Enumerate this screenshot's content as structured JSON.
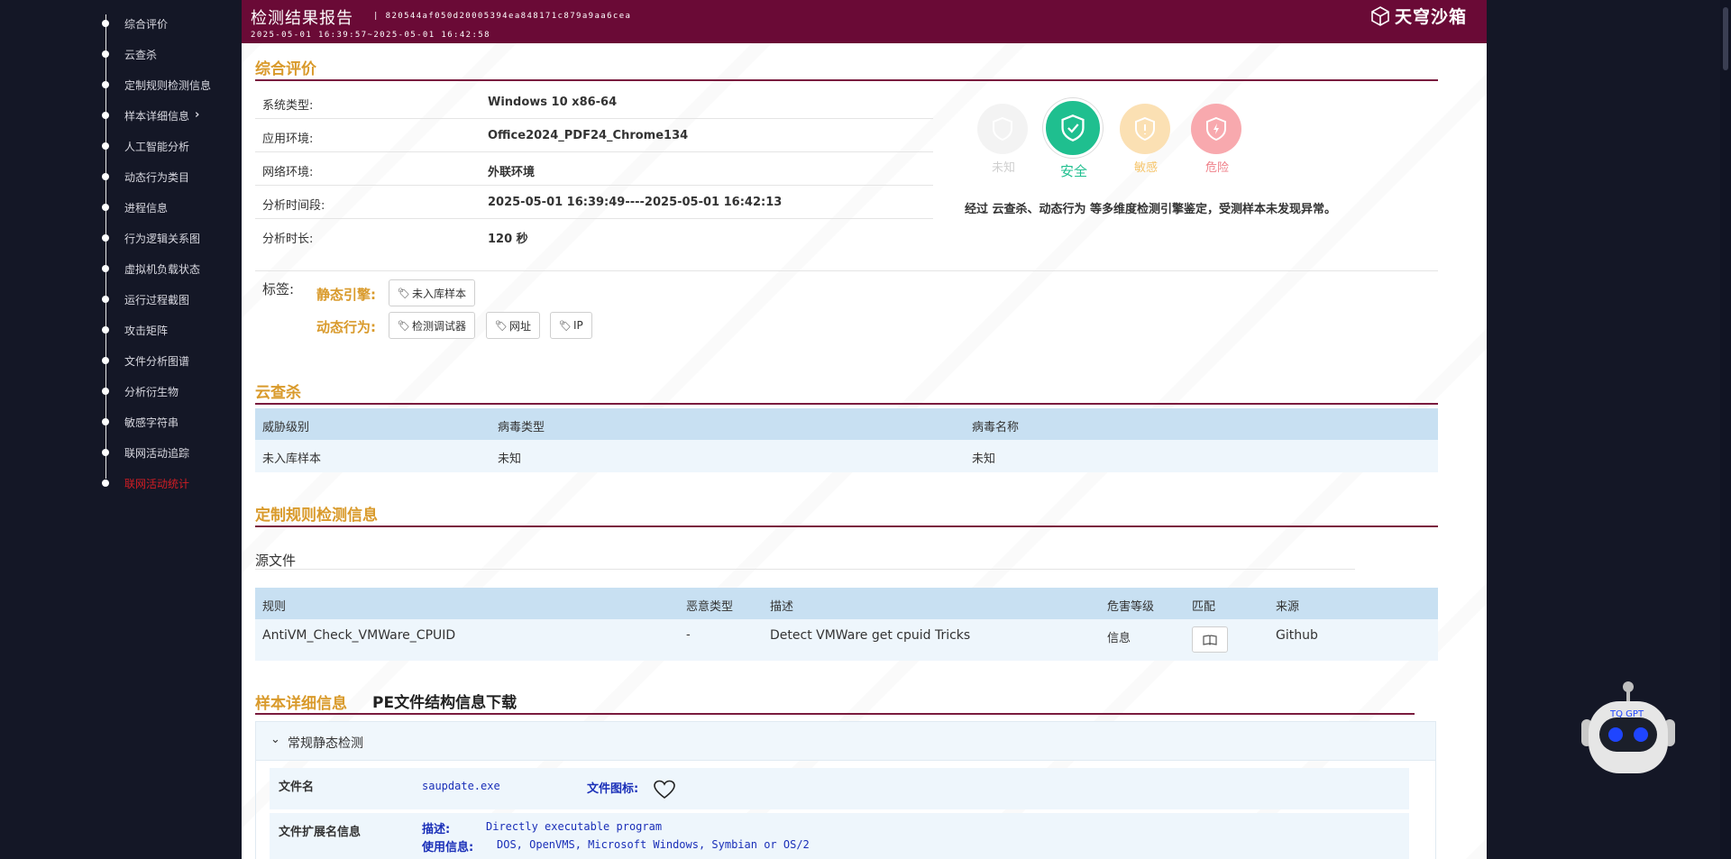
{
  "sidebar": {
    "items": [
      {
        "label": "综合评价"
      },
      {
        "label": "云查杀"
      },
      {
        "label": "定制规则检测信息"
      },
      {
        "label": "样本详细信息"
      },
      {
        "label": "人工智能分析"
      },
      {
        "label": "动态行为类目"
      },
      {
        "label": "进程信息"
      },
      {
        "label": "行为逻辑关系图"
      },
      {
        "label": "虚拟机负载状态"
      },
      {
        "label": "运行过程截图"
      },
      {
        "label": "攻击矩阵"
      },
      {
        "label": "文件分析图谱"
      },
      {
        "label": "分析衍生物"
      },
      {
        "label": "敏感字符串"
      },
      {
        "label": "联网活动追踪"
      },
      {
        "label": "联网活动统计"
      }
    ],
    "active_index": 15
  },
  "header": {
    "title": "检测结果报告",
    "hash": "| 820544af050d20005394ea848171c879a9aa6cea",
    "time_range": "2025-05-01 16:39:57~2025-05-01 16:42:58",
    "brand": "天穹沙箱"
  },
  "overview": {
    "title": "综合评价",
    "rows": [
      {
        "key": "系统类型:",
        "value": "Windows 10 x86-64"
      },
      {
        "key": "应用环境:",
        "value": "Office2024_PDF24_Chrome134"
      },
      {
        "key": "网络环境:",
        "value": "外联环境"
      },
      {
        "key": "分析时间段:",
        "value": "2025-05-01 16:39:49----2025-05-01 16:42:13"
      },
      {
        "key": "分析时长:",
        "value": "120 秒"
      }
    ],
    "verdicts": [
      {
        "label": "未知",
        "color": "#d8d8d8",
        "active": false
      },
      {
        "label": "安全",
        "color": "#1fbf8f",
        "active": true
      },
      {
        "label": "敏感",
        "color": "#f6c56b",
        "active": false
      },
      {
        "label": "危险",
        "color": "#ef5a67",
        "active": false
      }
    ],
    "verdict_text": "经过 云查杀、动态行为 等多维度检测引擎鉴定，受测样本未发现异常。",
    "tags_label": "标签:",
    "static_label": "静态引擎:",
    "static_tags": [
      "未入库样本"
    ],
    "dynamic_label": "动态行为:",
    "dynamic_tags": [
      "检测调试器",
      "网址",
      "IP"
    ]
  },
  "cloud": {
    "title": "云查杀",
    "headers": [
      "威胁级别",
      "病毒类型",
      "病毒名称"
    ],
    "row": [
      "未入库样本",
      "未知",
      "未知"
    ]
  },
  "custom_rules": {
    "title": "定制规则检测信息",
    "subtitle": "源文件",
    "headers": [
      "规则",
      "恶意类型",
      "描述",
      "危害等级",
      "匹配",
      "来源"
    ],
    "row": {
      "rule": "AntiVM_Check_VMWare_CPUID",
      "type": "-",
      "desc": "Detect VMWare get cpuid Tricks",
      "level": "信息",
      "source": "Github"
    }
  },
  "sample": {
    "title": "样本详细信息",
    "download": "PE文件结构信息下载",
    "collapse_title": "常规静态检测",
    "filename_key": "文件名",
    "filename_value": "saupdate.exe",
    "icon_key": "文件图标:",
    "ext_key": "文件扩展名信息",
    "desc_key": "描述:",
    "desc_value": "Directly executable program",
    "usage_key": "使用信息:",
    "usage_value": "DOS, OpenVMS, Microsoft Windows, Symbian or OS/2"
  },
  "robot": {
    "label": "TQ GPT"
  }
}
